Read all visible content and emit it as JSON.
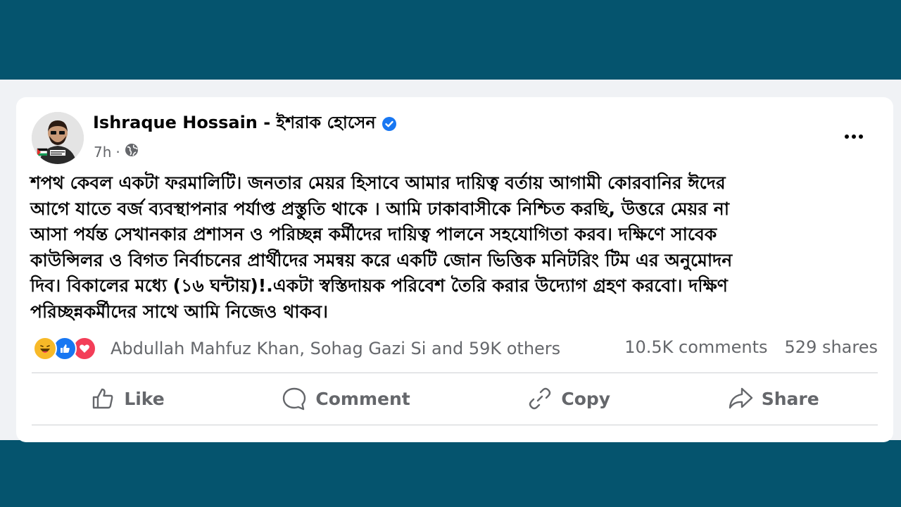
{
  "post": {
    "author": "Ishraque Hossain - ইশরাক হোসেন",
    "time": "7h",
    "text": "শপথ কেবল একটা ফরমালিটি। জনতার মেয়র হিসাবে আমার দায়িত্ব বর্তায় আগামী কোরবানির ঈদের\nআগে যাতে বর্জ ব্যবস্থাপনার পর্যাপ্ত প্রস্তুতি থাকে । আমি ঢাকাবাসীকে নিশ্চিত করছি,  উত্তরে মেয়র না\nআসা পর্যন্ত সেখানকার প্রশাসন ও পরিচ্ছন্ন কর্মীদের দায়িত্ব পালনে সহযোগিতা করব। দক্ষিণে সাবেক\nকাউন্সিলর ও বিগত নির্বাচনের প্রার্থীদের সমন্বয় করে একটি জোন ভিত্তিক মনিটরিং টিম এর অনুমোদন\nদিব। বিকালের মধ্যে (১৬ ঘন্টায়)!.একটা স্বস্তিদায়ক পরিবেশ তৈরি করার উদ্যোগ গ্রহণ করবো। দক্ষিণ\nপরিচ্ছন্নকর্মীদের সাথে আমি নিজেও থাকব।",
    "reactions_summary": "Abdullah Mahfuz Khan, Sohag Gazi Si and 59K others",
    "comments": "10.5K comments",
    "shares": "529 shares"
  },
  "actions": {
    "like": "Like",
    "comment": "Comment",
    "copy": "Copy",
    "share": "Share"
  },
  "icons": [
    "globe-icon",
    "verified-badge-icon",
    "more-options-icon",
    "haha-reaction-icon",
    "like-reaction-icon",
    "love-reaction-icon",
    "like-icon",
    "comment-icon",
    "copy-link-icon",
    "share-icon"
  ],
  "colors": {
    "frame": "#05546e",
    "verified": "#1877f2",
    "muted_text": "#65676b"
  }
}
